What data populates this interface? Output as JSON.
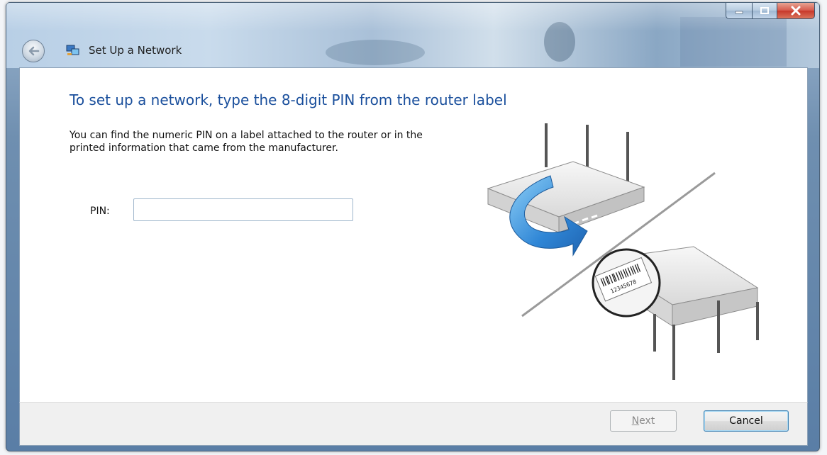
{
  "window": {
    "title": "Set Up a Network",
    "controls": {
      "minimize": "minimize-icon",
      "maximize": "maximize-icon",
      "close": "close-icon"
    }
  },
  "content": {
    "heading": "To set up a network, type the 8-digit PIN from the router label",
    "description": "You can find the numeric PIN on a label attached to the router or in the printed information that came from the manufacturer.",
    "pin": {
      "label": "PIN:",
      "value": ""
    },
    "illustration": {
      "label_text": "12345678"
    }
  },
  "footer": {
    "next_label": "Next",
    "cancel_label": "Cancel"
  },
  "colors": {
    "heading": "#1a4f9c",
    "close_button": "#c7372a",
    "arrow": "#2f86d6"
  }
}
